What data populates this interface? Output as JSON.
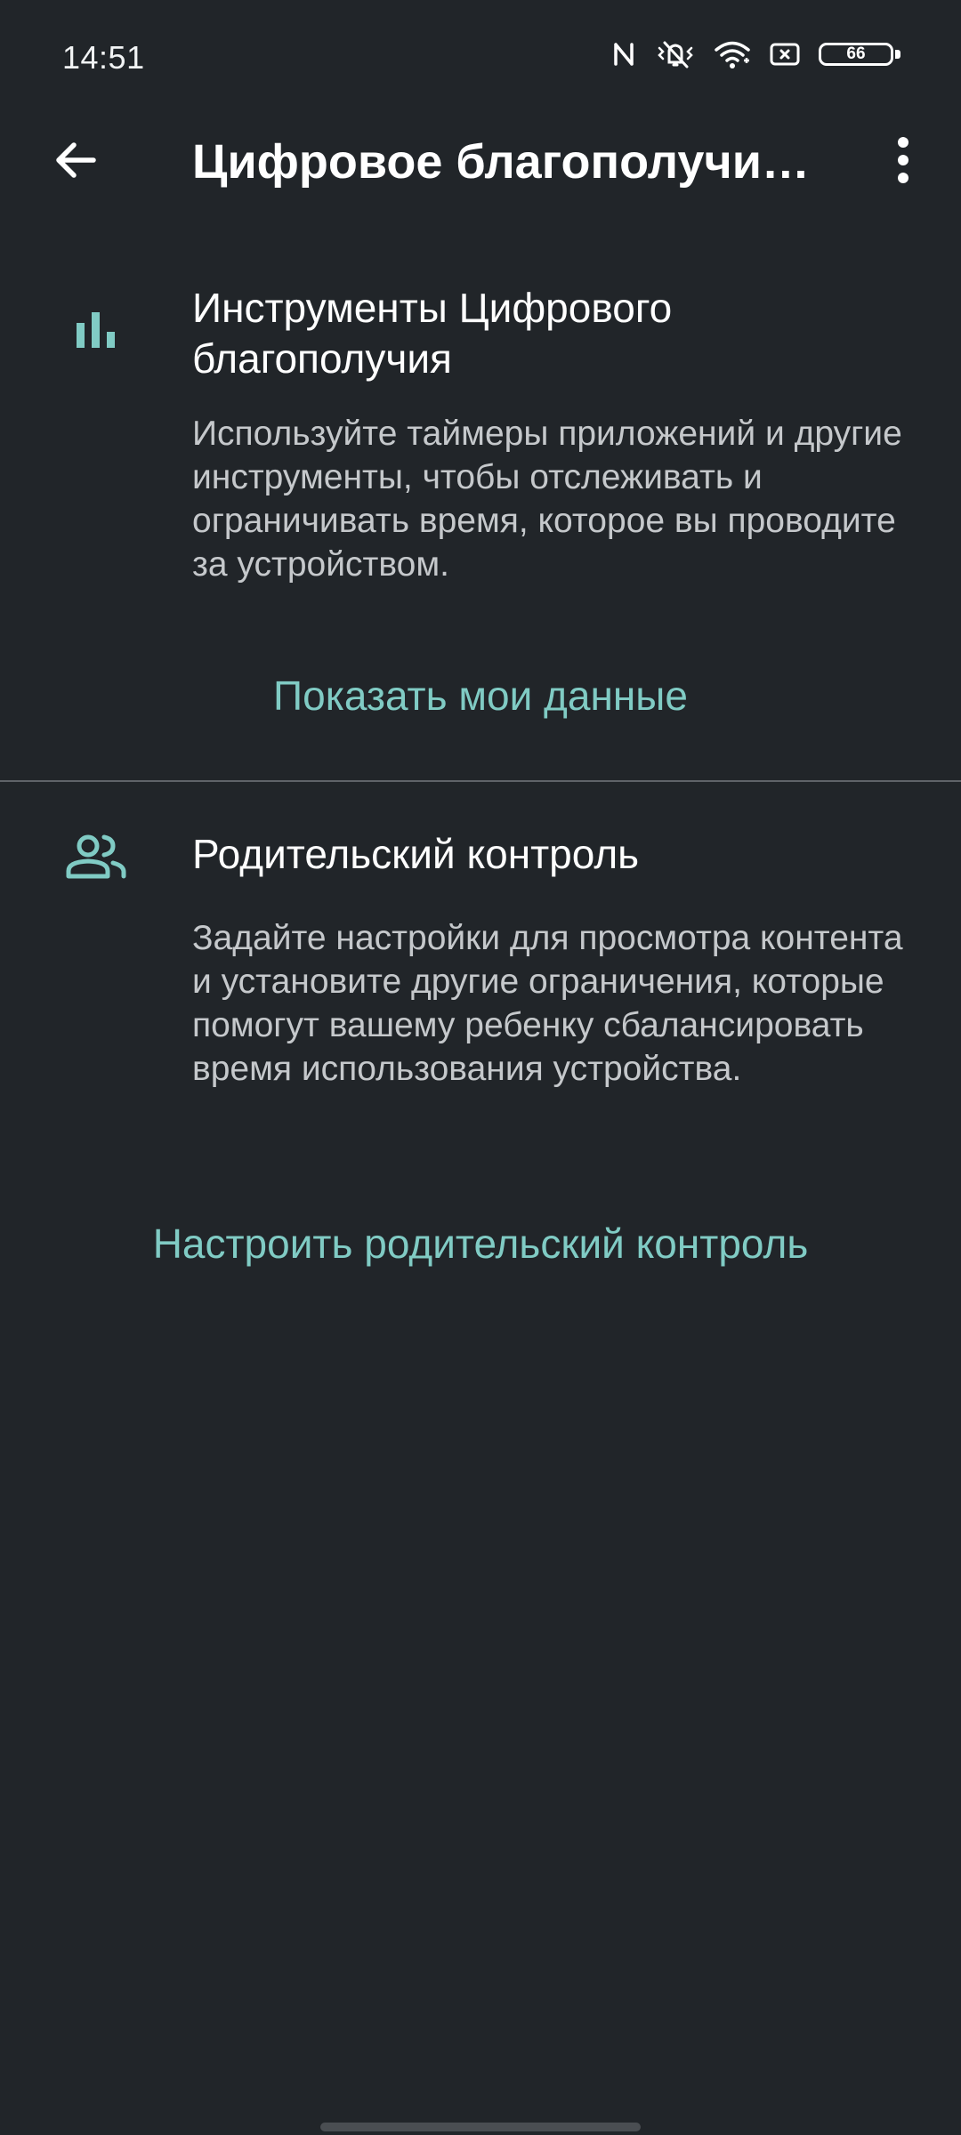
{
  "status_bar": {
    "time": "14:51",
    "battery_level": "66",
    "icons": [
      "nfc-icon",
      "vibrate-mute-icon",
      "wifi-icon",
      "screen-record-icon",
      "battery-icon"
    ]
  },
  "app_bar": {
    "title": "Цифровое благополучие и родительский контроль",
    "back_icon": "arrow-back-icon",
    "menu_icon": "more-vert-icon"
  },
  "sections": [
    {
      "icon": "bar-chart-icon",
      "title": "Инструменты Цифрового благополучия",
      "description": "Используйте таймеры приложений и другие инструменты, чтобы отслеживать и ограничивать время, которое вы проводите за устройством.",
      "action": "Показать мои данные"
    },
    {
      "icon": "people-icon",
      "title": "Родительский контроль",
      "description": "Задайте настройки для просмотра контента и установите другие ограничения, которые помогут вашему ребенку сбалансировать время использования устройства.",
      "action": "Настроить родительский контроль"
    }
  ],
  "colors": {
    "background": "#212529",
    "accent": "#80cbc4",
    "text_primary": "#ffffff",
    "text_secondary": "#c5c8cb",
    "divider": "#5f6368"
  }
}
